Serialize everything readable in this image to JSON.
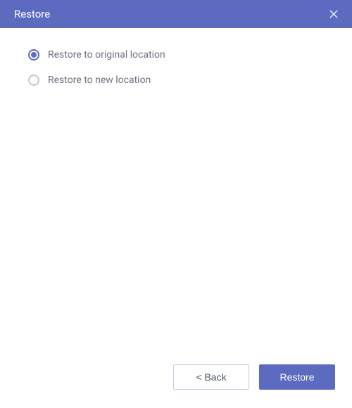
{
  "header": {
    "title": "Restore"
  },
  "options": {
    "original": {
      "label": "Restore to original location",
      "selected": true
    },
    "new": {
      "label": "Restore to new location",
      "selected": false
    }
  },
  "footer": {
    "back_label": "<  Back",
    "restore_label": "Restore"
  }
}
